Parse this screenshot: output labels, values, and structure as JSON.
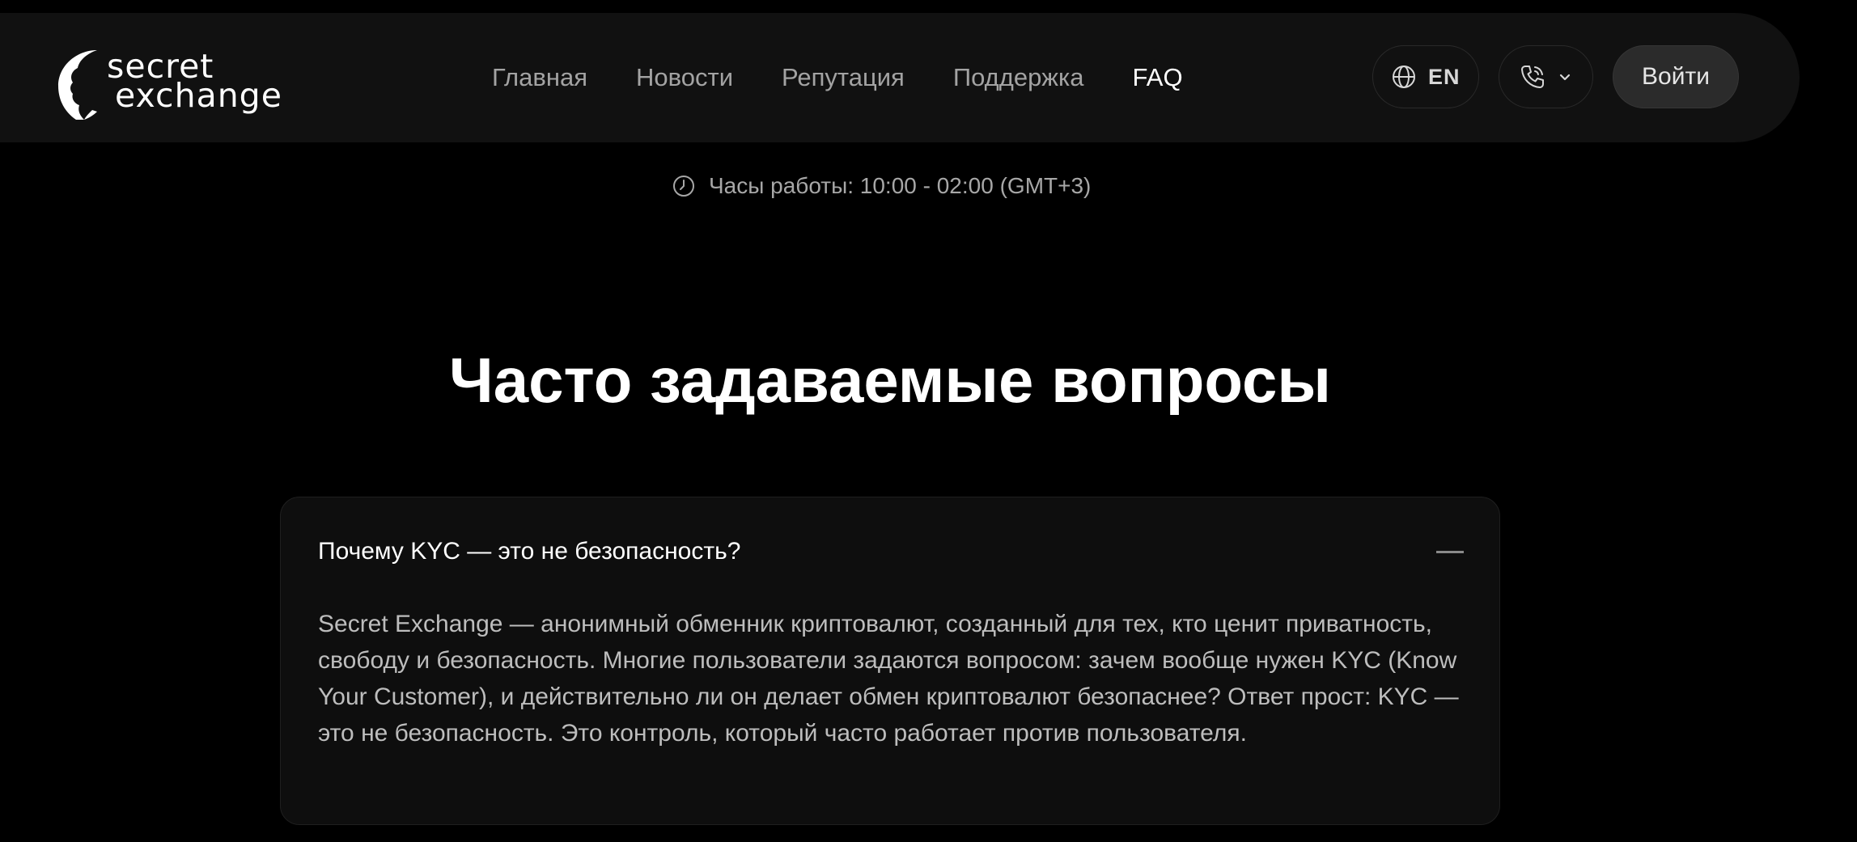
{
  "header": {
    "logo": {
      "line1": "secret",
      "line2": "exchange"
    },
    "nav": [
      {
        "label": "Главная",
        "active": false
      },
      {
        "label": "Новости",
        "active": false
      },
      {
        "label": "Репутация",
        "active": false
      },
      {
        "label": "Поддержка",
        "active": false
      },
      {
        "label": "FAQ",
        "active": true
      }
    ],
    "language": {
      "label": "EN",
      "icon": "globe-icon"
    },
    "phone": {
      "icon": "phone-icon",
      "chevron": "chevron-down-icon"
    },
    "login_label": "Войти"
  },
  "hours": {
    "icon": "clock-icon",
    "text": "Часы работы: 10:00 - 02:00 (GMT+3)"
  },
  "main": {
    "title": "Часто задаваемые вопросы",
    "faq": [
      {
        "question": "Почему KYC — это не безопасность?",
        "expanded": true,
        "toggle_icon": "minus-icon",
        "answer": "Secret Exchange — анонимный обменник криптовалют, созданный для тех, кто ценит приватность, свободу и безопасность. Многие пользователи задаются вопросом: зачем вообще нужен KYC (Know Your Customer), и действительно ли он делает обмен криптовалют безопаснее?  Ответ прост: KYC — это не безопасность. Это контроль, который часто работает против пользователя."
      }
    ]
  },
  "colors": {
    "background": "#000000",
    "header_bg": "#111111",
    "nav_inactive": "#a3a3a3",
    "nav_active": "#ffffff",
    "card_bg": "#0e0e0e",
    "button_bg": "#2b2b2b"
  }
}
